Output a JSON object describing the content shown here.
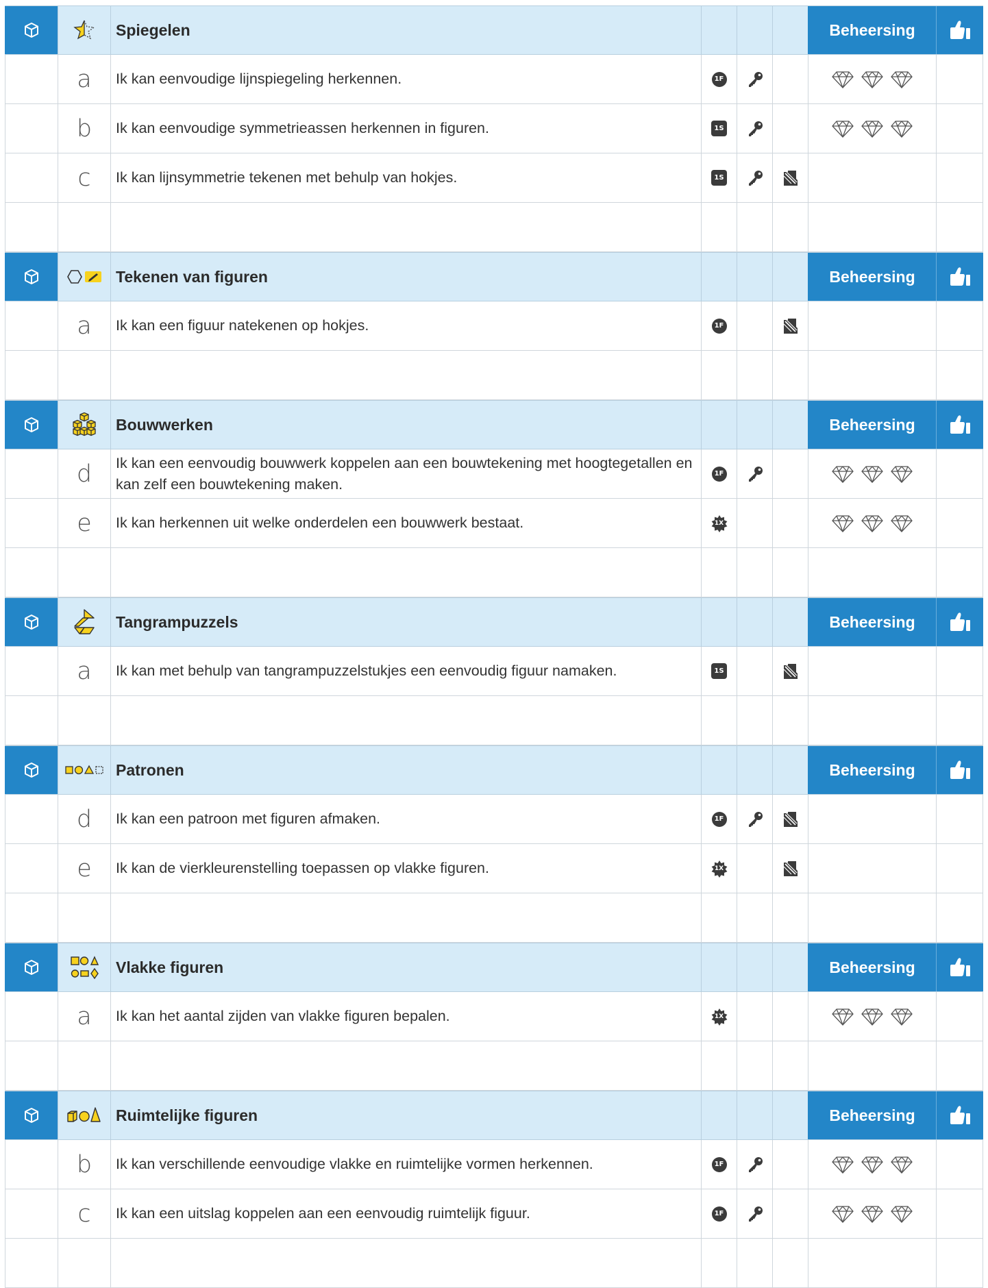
{
  "level_column_label": "Beheersing",
  "sections": [
    {
      "title": "Spiegelen",
      "topic_icon": "star-mirror-icon",
      "items": [
        {
          "letter": "a",
          "text": "Ik kan eenvoudige lijnspiegeling herkennen.",
          "badge": "1F",
          "badge_shape": "circle",
          "key": true,
          "exercise": false,
          "diamonds": true
        },
        {
          "letter": "b",
          "text": "Ik kan eenvoudige symmetrieassen herkennen in figuren.",
          "badge": "1S",
          "badge_shape": "square",
          "key": true,
          "exercise": false,
          "diamonds": true
        },
        {
          "letter": "c",
          "text": "Ik kan lijnsymmetrie tekenen met behulp van hokjes.",
          "badge": "1S",
          "badge_shape": "square",
          "key": true,
          "exercise": true,
          "diamonds": false
        }
      ]
    },
    {
      "title": "Tekenen van figuren",
      "topic_icon": "hexagon-pencil-icon",
      "items": [
        {
          "letter": "a",
          "text": "Ik kan een figuur natekenen op hokjes.",
          "badge": "1F",
          "badge_shape": "circle",
          "key": false,
          "exercise": true,
          "diamonds": false
        }
      ]
    },
    {
      "title": "Bouwwerken",
      "topic_icon": "cube-stack-icon",
      "items": [
        {
          "letter": "d",
          "text": "Ik kan een eenvoudig bouwwerk koppelen aan een bouwtekening met hoogtegetallen en kan zelf een bouwtekening maken.",
          "badge": "1F",
          "badge_shape": "circle",
          "key": true,
          "exercise": false,
          "diamonds": true
        },
        {
          "letter": "e",
          "text": "Ik kan herkennen uit welke onderdelen een bouwwerk bestaat.",
          "badge": "1X",
          "badge_shape": "star",
          "key": false,
          "exercise": false,
          "diamonds": true
        }
      ]
    },
    {
      "title": "Tangrampuzzels",
      "topic_icon": "tangram-icon",
      "items": [
        {
          "letter": "a",
          "text": "Ik kan met behulp van tangrampuzzelstukjes een eenvoudig figuur namaken.",
          "badge": "1S",
          "badge_shape": "square",
          "key": false,
          "exercise": true,
          "diamonds": false
        }
      ]
    },
    {
      "title": "Patronen",
      "topic_icon": "shape-pattern-icon",
      "items": [
        {
          "letter": "d",
          "text": "Ik kan een patroon met figuren afmaken.",
          "badge": "1F",
          "badge_shape": "circle",
          "key": true,
          "exercise": true,
          "diamonds": false
        },
        {
          "letter": "e",
          "text": "Ik kan de vierkleurenstelling toepassen op vlakke figuren.",
          "badge": "1X",
          "badge_shape": "star",
          "key": false,
          "exercise": true,
          "diamonds": false
        }
      ]
    },
    {
      "title": "Vlakke figuren",
      "topic_icon": "flat-shapes-icon",
      "items": [
        {
          "letter": "a",
          "text": "Ik kan het aantal zijden van vlakke figuren bepalen.",
          "badge": "1X",
          "badge_shape": "star",
          "key": false,
          "exercise": false,
          "diamonds": true
        }
      ]
    },
    {
      "title": "Ruimtelijke figuren",
      "topic_icon": "solid-shapes-icon",
      "items": [
        {
          "letter": "b",
          "text": "Ik kan verschillende eenvoudige vlakke en ruimtelijke vormen herkennen.",
          "badge": "1F",
          "badge_shape": "circle",
          "key": true,
          "exercise": false,
          "diamonds": true
        },
        {
          "letter": "c",
          "text": "Ik kan een uitslag koppelen aan een eenvoudig ruimtelijk figuur.",
          "badge": "1F",
          "badge_shape": "circle",
          "key": true,
          "exercise": false,
          "diamonds": true
        }
      ]
    }
  ],
  "colors": {
    "header_blue": "#2386c8",
    "header_light": "#d6ebf8",
    "icon_yellow": "#f7d21e",
    "badge_dark": "#3b3b3b"
  }
}
